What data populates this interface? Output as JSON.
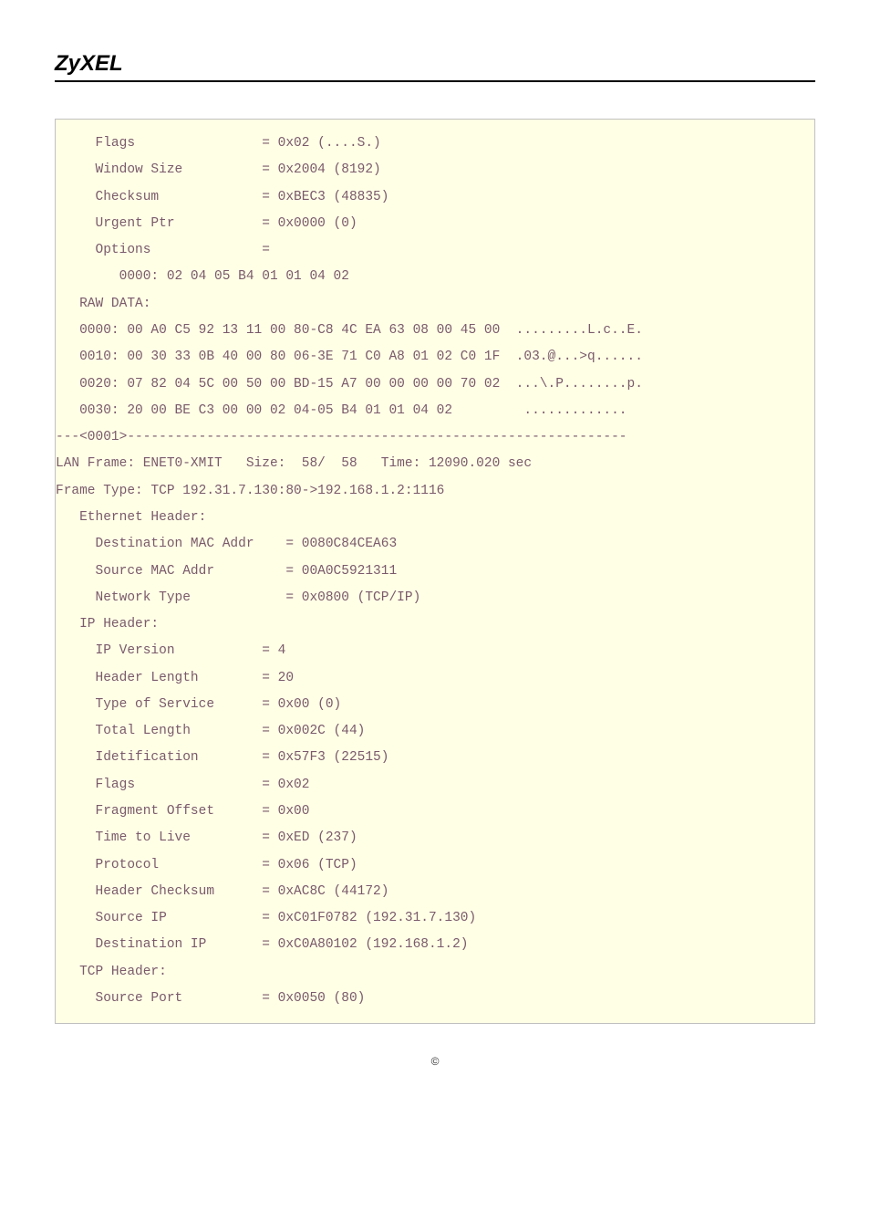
{
  "logo": "ZyXEL",
  "lines": {
    "l0": "     Flags                = 0x02 (....S.)",
    "l1": "     Window Size          = 0x2004 (8192)",
    "l2": "     Checksum             = 0xBEC3 (48835)",
    "l3": "     Urgent Ptr           = 0x0000 (0)",
    "l4": "     Options              =",
    "l5": "        0000: 02 04 05 B4 01 01 04 02",
    "l6": "",
    "l7": "   RAW DATA:",
    "l8": "   0000: 00 A0 C5 92 13 11 00 80-C8 4C EA 63 08 00 45 00  .........L.c..E.",
    "l9": "   0010: 00 30 33 0B 40 00 80 06-3E 71 C0 A8 01 02 C0 1F  .03.@...>q......",
    "l10": "   0020: 07 82 04 5C 00 50 00 BD-15 A7 00 00 00 00 70 02  ...\\.P........p.",
    "l11": "   0030: 20 00 BE C3 00 00 02 04-05 B4 01 01 04 02         .............",
    "l12": "---<0001>---------------------------------------------------------------",
    "l13": "LAN Frame: ENET0-XMIT   Size:  58/  58   Time: 12090.020 sec",
    "l14": "Frame Type: TCP 192.31.7.130:80->192.168.1.2:1116",
    "l15": "",
    "l16": "   Ethernet Header:",
    "l17": "     Destination MAC Addr    = 0080C84CEA63",
    "l18": "     Source MAC Addr         = 00A0C5921311",
    "l19": "     Network Type            = 0x0800 (TCP/IP)",
    "l20": "",
    "l21": "   IP Header:",
    "l22": "     IP Version           = 4",
    "l23": "     Header Length        = 20",
    "l24": "     Type of Service      = 0x00 (0)",
    "l25": "     Total Length         = 0x002C (44)",
    "l26": "     Idetification        = 0x57F3 (22515)",
    "l27": "     Flags                = 0x02",
    "l28": "     Fragment Offset      = 0x00",
    "l29": "     Time to Live         = 0xED (237)",
    "l30": "     Protocol             = 0x06 (TCP)",
    "l31": "     Header Checksum      = 0xAC8C (44172)",
    "l32": "     Source IP            = 0xC01F0782 (192.31.7.130)",
    "l33": "     Destination IP       = 0xC0A80102 (192.168.1.2)",
    "l34": "",
    "l35": "   TCP Header:",
    "l36": "     Source Port          = 0x0050 (80)"
  },
  "footer": "©"
}
